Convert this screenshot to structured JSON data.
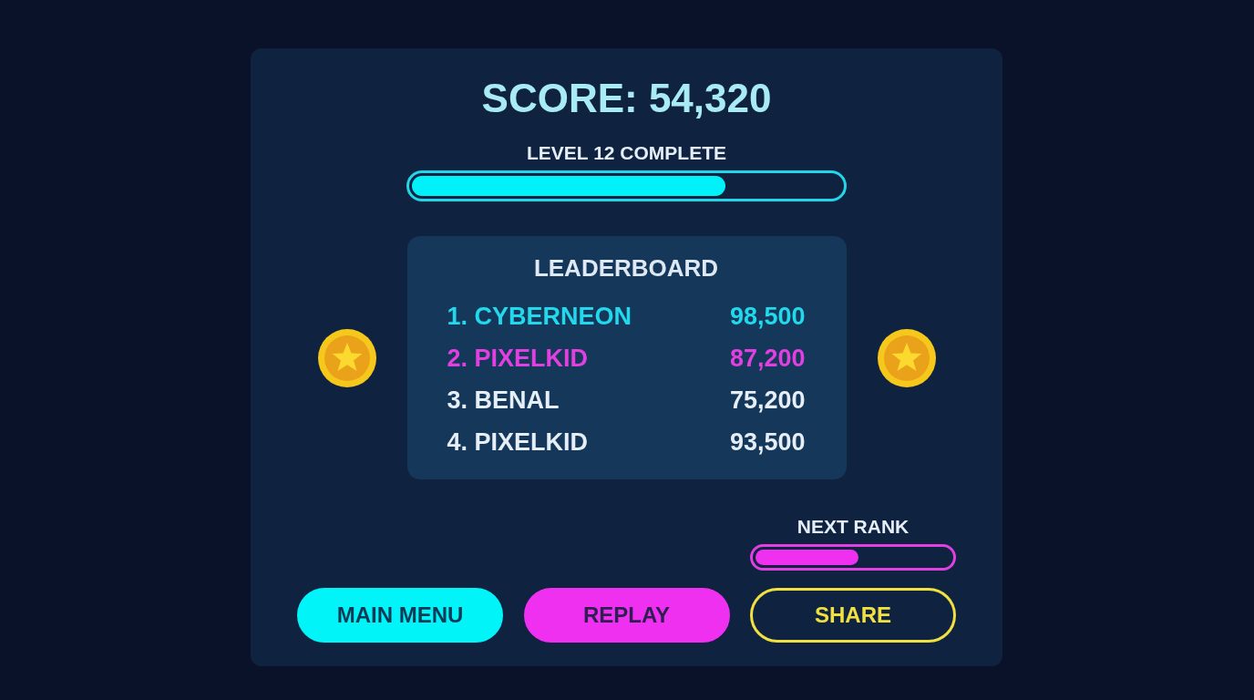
{
  "score": "SCORE: 54,320",
  "level_progress": {
    "label": "LEVEL 12 COMPLETE",
    "level": 0.73
  },
  "leaderboard": {
    "title": "LEADERBOARD",
    "rows": [
      {
        "name": "1. CYBERNEON",
        "score": "98,500",
        "color": "#22d8ec"
      },
      {
        "name": "2. PIXELKID",
        "score": "87,200",
        "color": "#e040e0"
      },
      {
        "name": "3. BENAL",
        "score": "75,200",
        "color": "#e6eef8"
      },
      {
        "name": "4. PIXELKID",
        "score": "93,500",
        "color": "#e6eef8"
      }
    ]
  },
  "next_rank": {
    "label": "NEXT RANK",
    "level": 0.53
  },
  "buttons": [
    {
      "label": "MAIN MENU",
      "kind": "filled",
      "color": "#00f4f8"
    },
    {
      "label": "REPLAY",
      "kind": "filled",
      "color": "#f030f0"
    },
    {
      "label": "SHARE",
      "kind": "outline",
      "color": "#f0e040"
    }
  ]
}
